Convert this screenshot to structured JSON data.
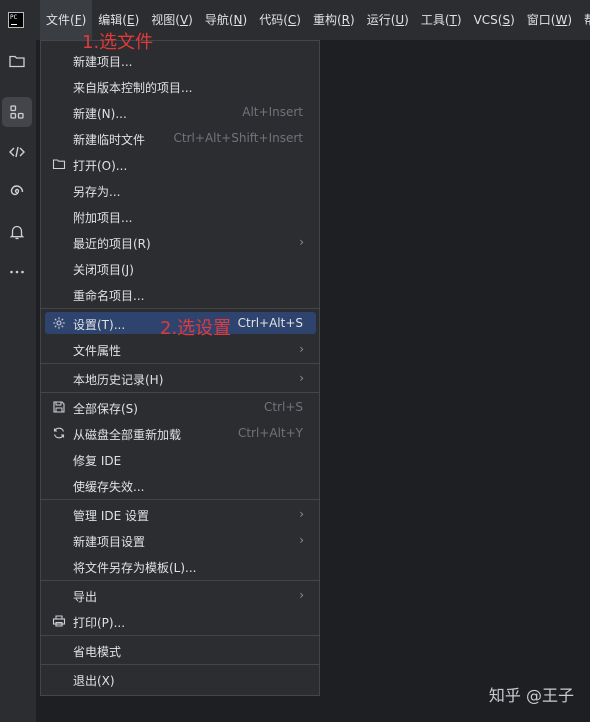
{
  "app": {
    "logo_text": "PC"
  },
  "menubar": {
    "items": [
      {
        "text": "文件(",
        "mn": "F",
        "end": ")"
      },
      {
        "text": "编辑(",
        "mn": "E",
        "end": ")"
      },
      {
        "text": "视图(",
        "mn": "V",
        "end": ")"
      },
      {
        "text": "导航(",
        "mn": "N",
        "end": ")"
      },
      {
        "text": "代码(",
        "mn": "C",
        "end": ")"
      },
      {
        "text": "重构(",
        "mn": "R",
        "end": ")"
      },
      {
        "text": "运行(",
        "mn": "U",
        "end": ")"
      },
      {
        "text": "工具(",
        "mn": "T",
        "end": ")"
      },
      {
        "text": "VCS(",
        "mn": "S",
        "end": ")"
      },
      {
        "text": "窗口(",
        "mn": "W",
        "end": ")"
      },
      {
        "text": "帮助",
        "mn": "",
        "end": ""
      }
    ]
  },
  "toolstrip": {
    "icons": [
      "folder-icon",
      "structure-icon",
      "code-icon",
      "spiral-icon",
      "bell-icon",
      "more-icon"
    ]
  },
  "file_menu": {
    "items": [
      {
        "label": "新建项目...",
        "shortcut": ""
      },
      {
        "label": "来自版本控制的项目...",
        "shortcut": ""
      },
      {
        "label": "新建(N)...",
        "shortcut": "Alt+Insert"
      },
      {
        "label": "新建临时文件",
        "shortcut": "Ctrl+Alt+Shift+Insert"
      },
      {
        "label": "打开(O)...",
        "shortcut": "",
        "icon": "folder-icon"
      },
      {
        "label": "另存为...",
        "shortcut": ""
      },
      {
        "label": "附加项目...",
        "shortcut": ""
      },
      {
        "label": "最近的项目(R)",
        "shortcut": "",
        "submenu": true
      },
      {
        "label": "关闭项目(J)",
        "shortcut": ""
      },
      {
        "label": "重命名项目...",
        "shortcut": ""
      },
      {
        "label": "设置(T)...",
        "shortcut": "Ctrl+Alt+S",
        "icon": "gear-icon"
      },
      {
        "label": "文件属性",
        "shortcut": "",
        "submenu": true
      },
      {
        "label": "本地历史记录(H)",
        "shortcut": "",
        "submenu": true
      },
      {
        "label": "全部保存(S)",
        "shortcut": "Ctrl+S",
        "icon": "save-icon"
      },
      {
        "label": "从磁盘全部重新加载",
        "shortcut": "Ctrl+Alt+Y",
        "icon": "reload-icon"
      },
      {
        "label": "修复 IDE",
        "shortcut": ""
      },
      {
        "label": "使缓存失效...",
        "shortcut": ""
      },
      {
        "label": "管理 IDE 设置",
        "shortcut": "",
        "submenu": true
      },
      {
        "label": "新建项目设置",
        "shortcut": "",
        "submenu": true
      },
      {
        "label": "将文件另存为模板(L)...",
        "shortcut": ""
      },
      {
        "label": "导出",
        "shortcut": "",
        "submenu": true
      },
      {
        "label": "打印(P)...",
        "shortcut": "",
        "icon": "print-icon"
      },
      {
        "label": "省电模式",
        "shortcut": ""
      },
      {
        "label": "退出(X)",
        "shortcut": ""
      }
    ],
    "chevron": "›"
  },
  "annotations": {
    "step1": "1.选文件",
    "step2": "2.选设置"
  },
  "watermark": "知乎 @王子"
}
